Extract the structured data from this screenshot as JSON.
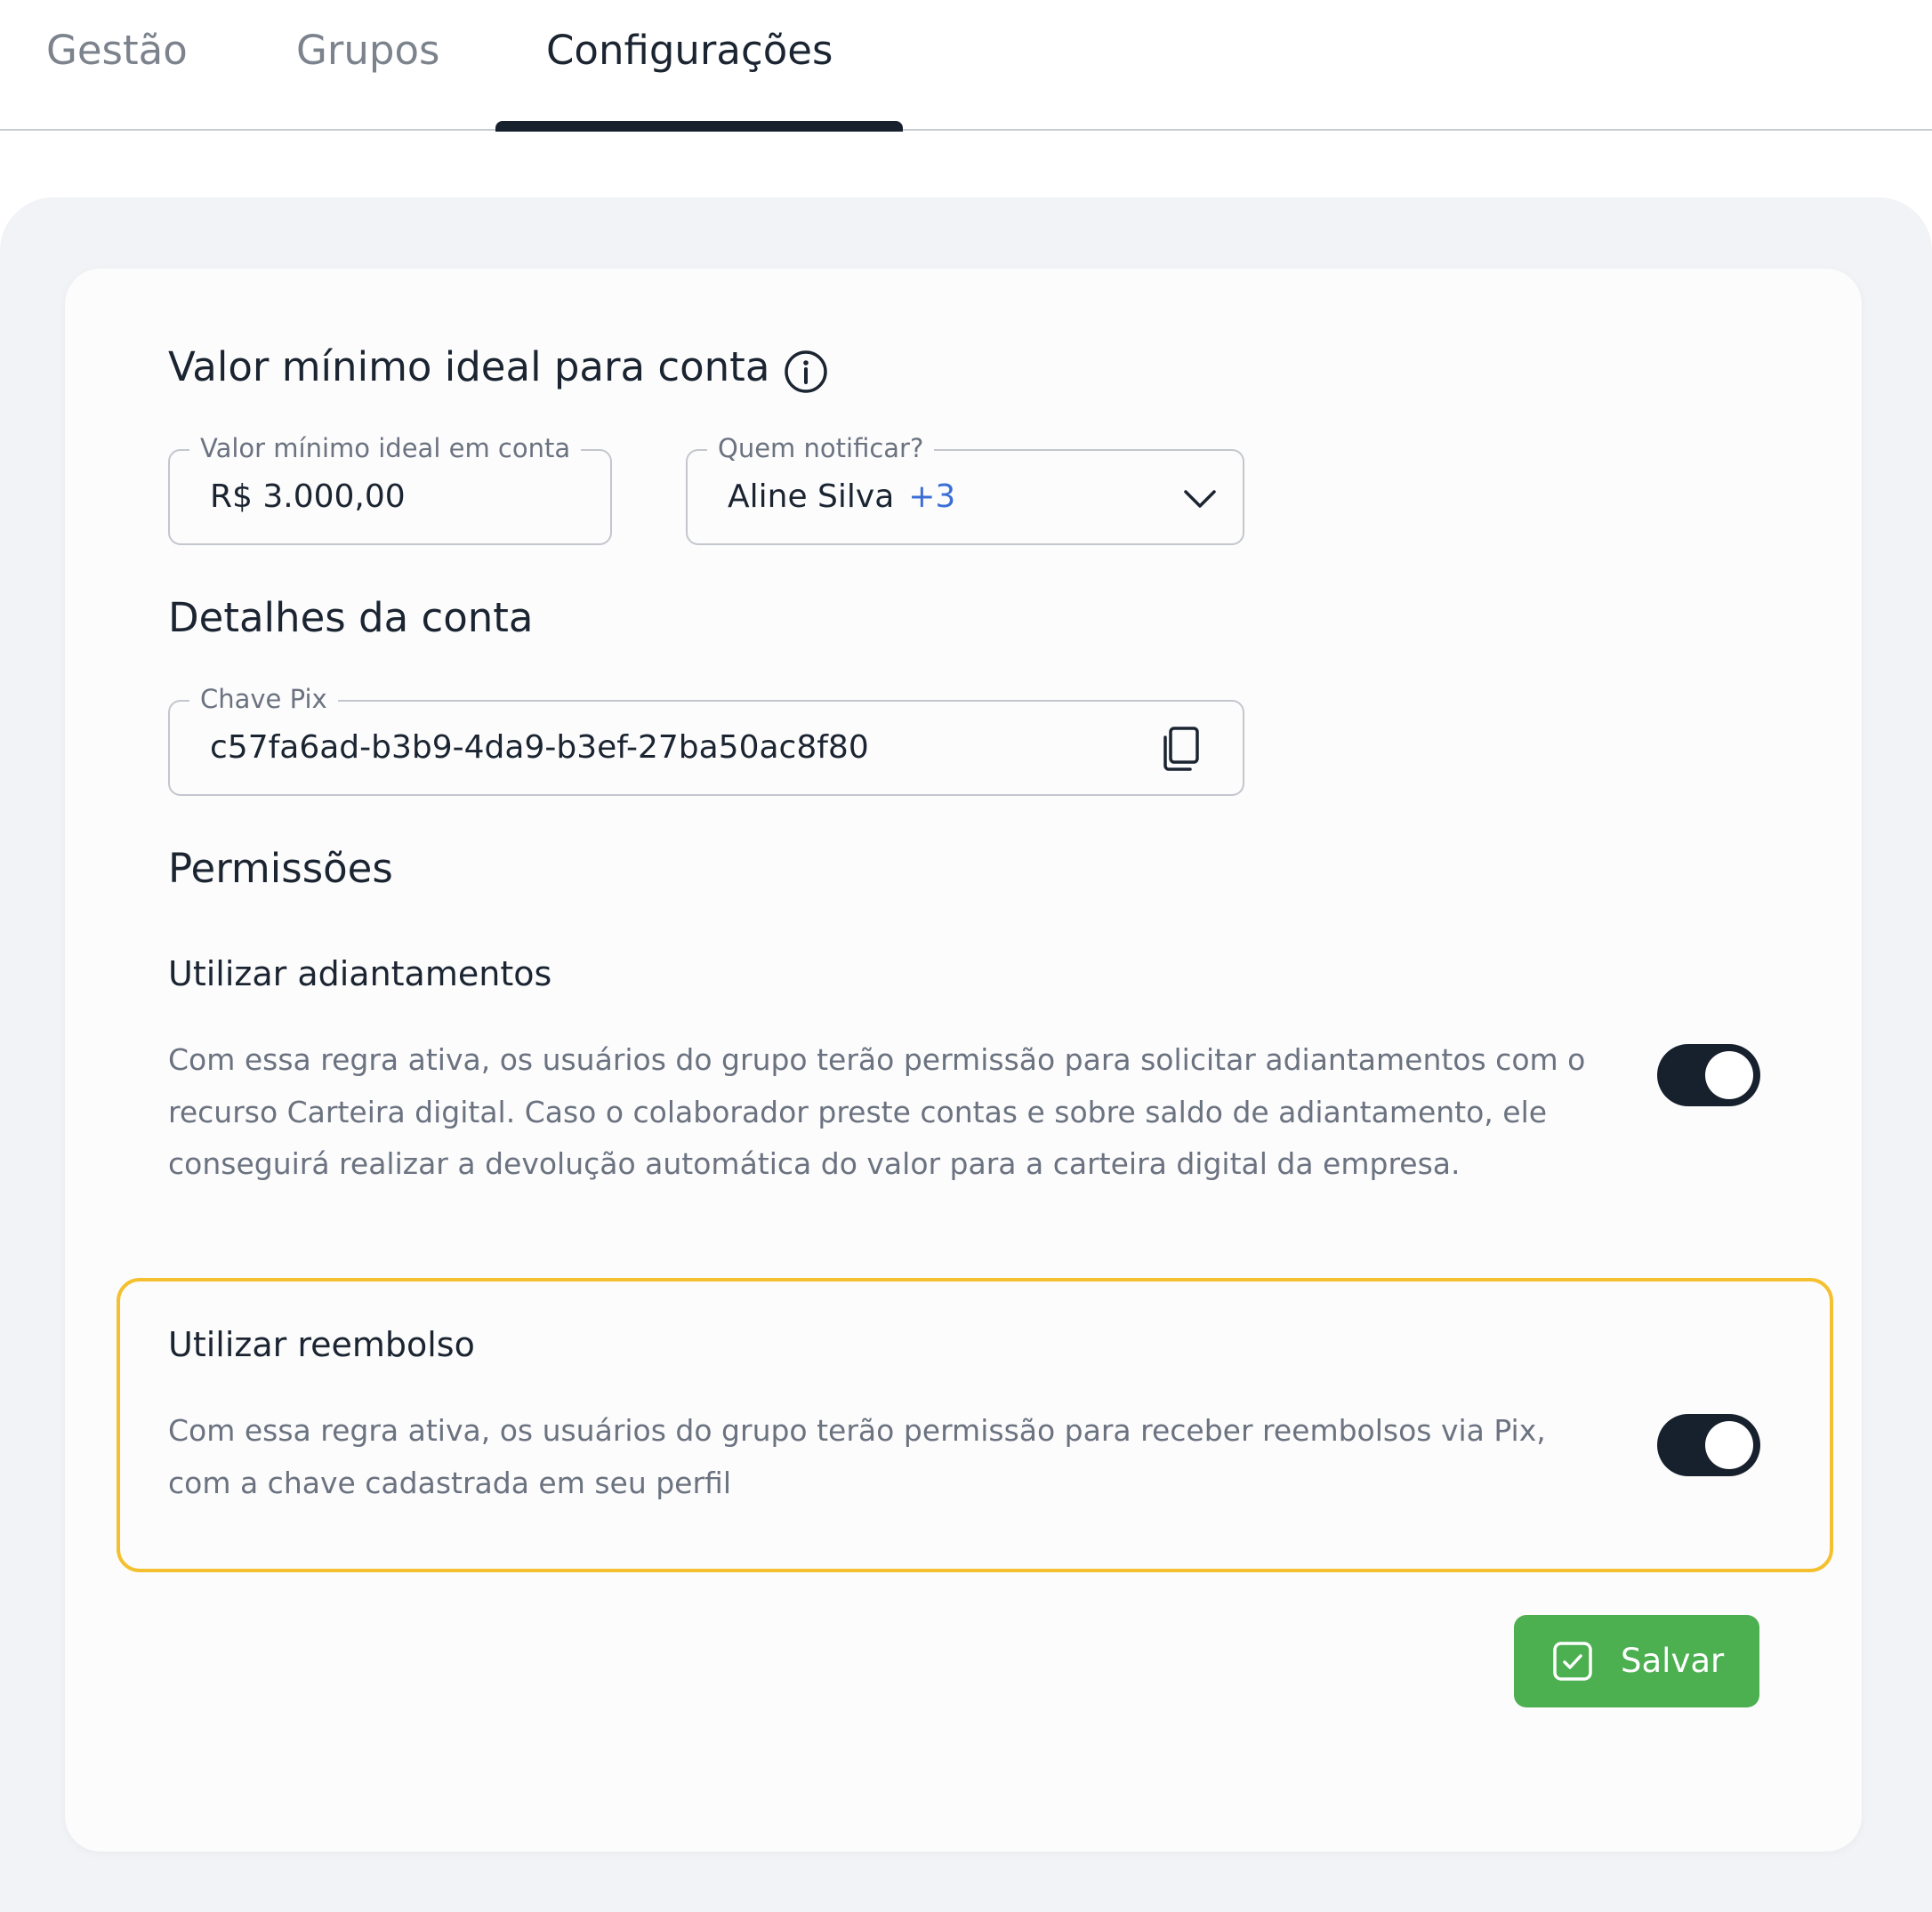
{
  "tabs": [
    {
      "label": "Gestão",
      "active": false
    },
    {
      "label": "Grupos",
      "active": false
    },
    {
      "label": "Configurações",
      "active": true
    }
  ],
  "min_balance": {
    "heading": "Valor mínimo ideal para conta",
    "info_icon": "info-icon",
    "amount_field": {
      "label": "Valor mínimo ideal em conta",
      "value": "R$ 3.000,00"
    },
    "notify_field": {
      "label": "Quem notificar?",
      "selected": "Aline Silva",
      "extra_count": "+3",
      "icon": "chevron-down-icon"
    }
  },
  "account_details": {
    "heading": "Detalhes da conta",
    "pix_field": {
      "label": "Chave Pix",
      "value": "c57fa6ad-b3b9-4da9-b3ef-27ba50ac8f80",
      "icon": "copy-icon"
    }
  },
  "permissions": {
    "heading": "Permissões",
    "items": [
      {
        "title": "Utilizar adiantamentos",
        "description": "Com essa regra ativa, os usuários do grupo terão permissão para solicitar adiantamentos com o recurso Carteira digital. Caso o colaborador preste contas e sobre saldo de adiantamento, ele conseguirá realizar a devolução automática do valor para a carteira digital da empresa.",
        "enabled": true,
        "highlighted": false
      },
      {
        "title": "Utilizar reembolso",
        "description": "Com essa regra ativa, os usuários do grupo terão permissão para receber reembolsos via Pix, com a chave cadastrada em seu perfil",
        "enabled": true,
        "highlighted": true
      }
    ]
  },
  "actions": {
    "save_label": "Salvar",
    "save_icon": "check-square-icon"
  },
  "colors": {
    "accent_dark": "#17202d",
    "save_green": "#4caf50",
    "highlight_yellow": "#f5c02f",
    "link_blue": "#3b6fd6",
    "panel_grey": "#f2f3f6"
  }
}
